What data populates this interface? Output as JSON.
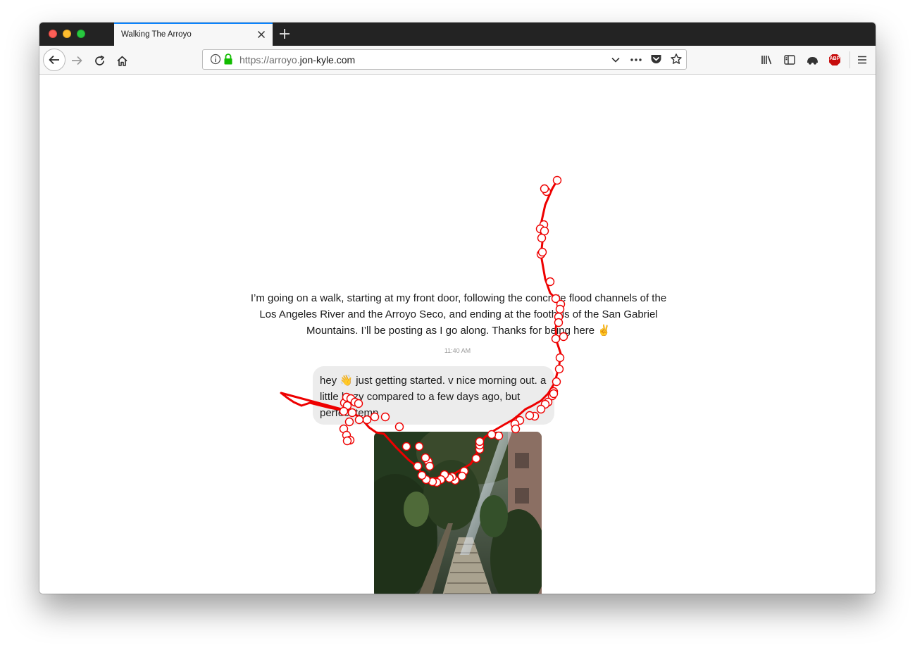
{
  "browser": {
    "tab_title": "Walking The Arroyo",
    "url_prefix": "https://arroyo.",
    "url_host": "jon-kyle.com",
    "accent_color": "#0a84ff",
    "icons": [
      "back-icon",
      "forward-icon",
      "reload-icon",
      "home-icon",
      "info-icon",
      "lock-icon",
      "dropdown-icon",
      "page-actions-icon",
      "pocket-icon",
      "bookmark-star-icon",
      "library-icon",
      "sidebar-icon",
      "tracking-icon",
      "adblock-icon",
      "menu-icon"
    ],
    "adblock_label": "ABP"
  },
  "page": {
    "intro_text": "I’m going on a walk, starting at my front door, following the concrete flood channels of the Los Angeles River and the Arroyo Seco, and ending at the foothills of the San Gabriel Mountains. I’ll be posting as I go along. Thanks for being here ✌️",
    "timestamp": "11:40 AM",
    "message_text": "hey 👋 just getting started. v nice morning out. a little hazy compared to a few days ago, but perfect temp",
    "route_color": "#ee0000"
  }
}
